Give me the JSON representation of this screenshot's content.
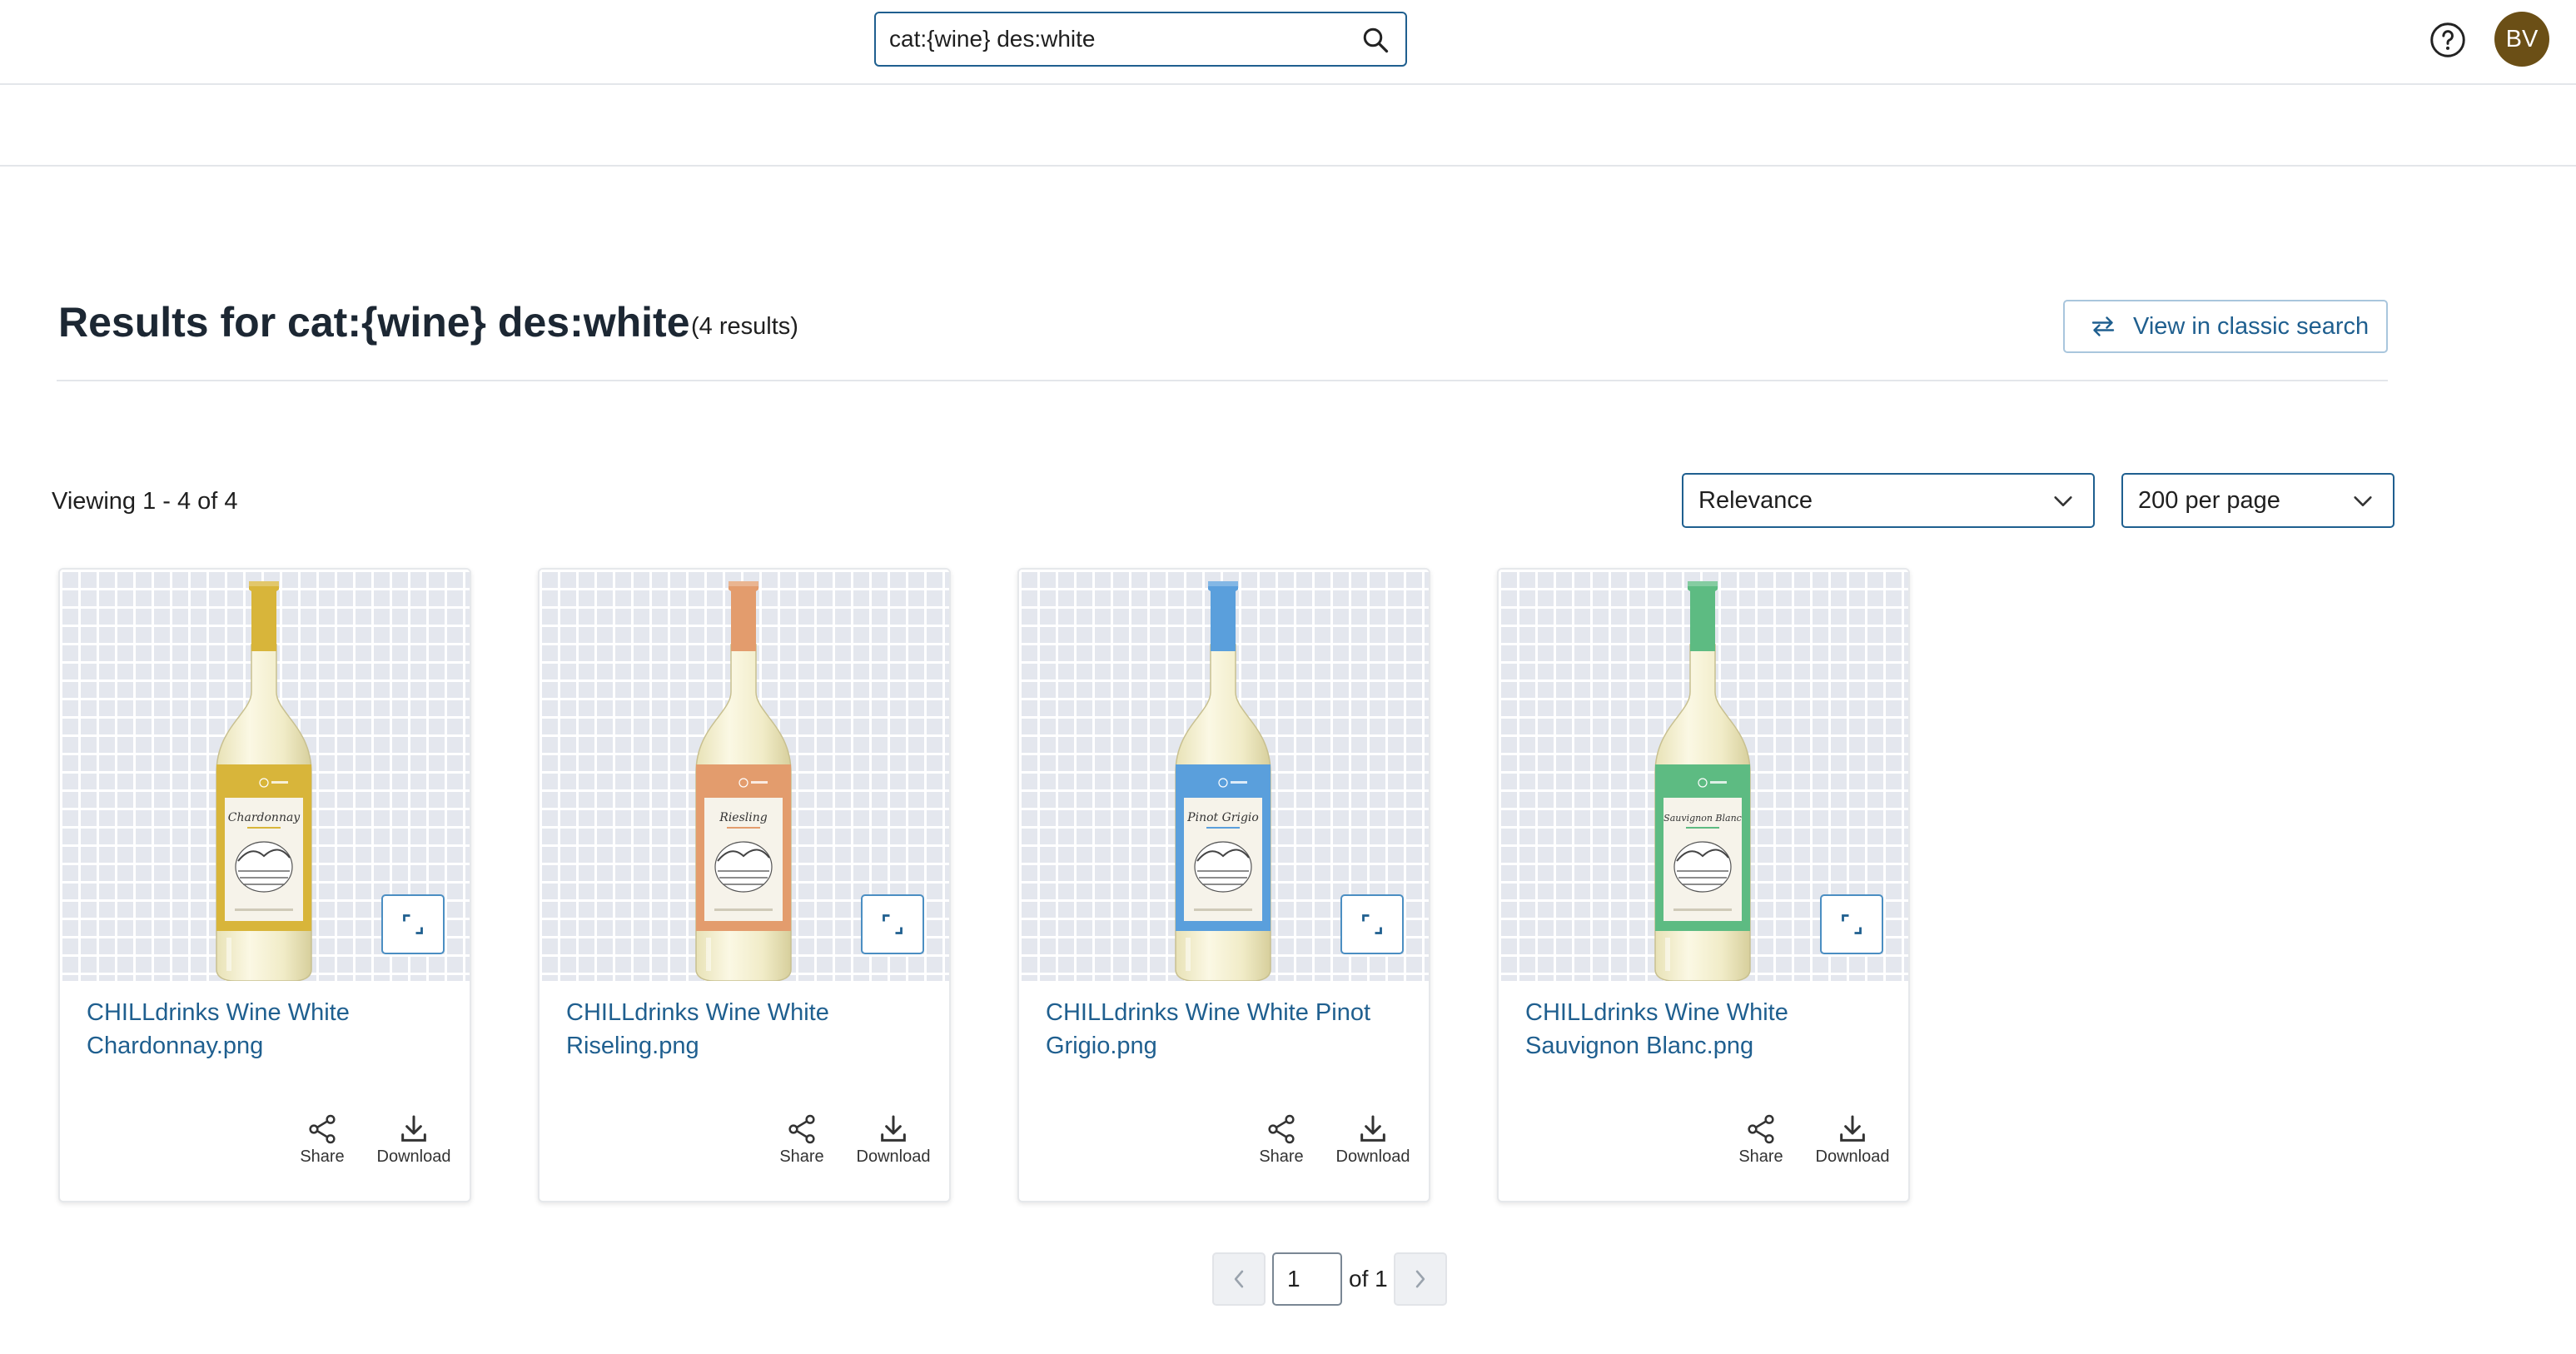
{
  "search": {
    "value": "cat:{wine} des:white"
  },
  "user": {
    "initials": "BV"
  },
  "results": {
    "title": "Results for cat:{wine} des:white",
    "count": "(4 results)",
    "classic_button": "View in classic search",
    "viewing": "Viewing 1 - 4 of 4"
  },
  "sort": {
    "selected": "Relevance"
  },
  "per_page": {
    "selected": "200 per page"
  },
  "actions": {
    "share": "Share",
    "download": "Download"
  },
  "items": [
    {
      "title": "CHILLdrinks Wine White Chardonnay.png",
      "label_text": "Chardonnay",
      "color": "#d8b53a"
    },
    {
      "title": "CHILLdrinks Wine White Riseling.png",
      "label_text": "Riesling",
      "color": "#e39c6d"
    },
    {
      "title": "CHILLdrinks Wine White Pinot Grigio.png",
      "label_text": "Pinot Grigio",
      "color": "#5a9fdc"
    },
    {
      "title": "CHILLdrinks Wine White Sauvignon Blanc.png",
      "label_text": "Sauvignon Blanc",
      "color": "#5dbb82"
    }
  ],
  "pagination": {
    "page": "1",
    "of_text": "of 1"
  },
  "colors": {
    "accent": "#1f5f8f",
    "avatar": "#6b4f16"
  }
}
